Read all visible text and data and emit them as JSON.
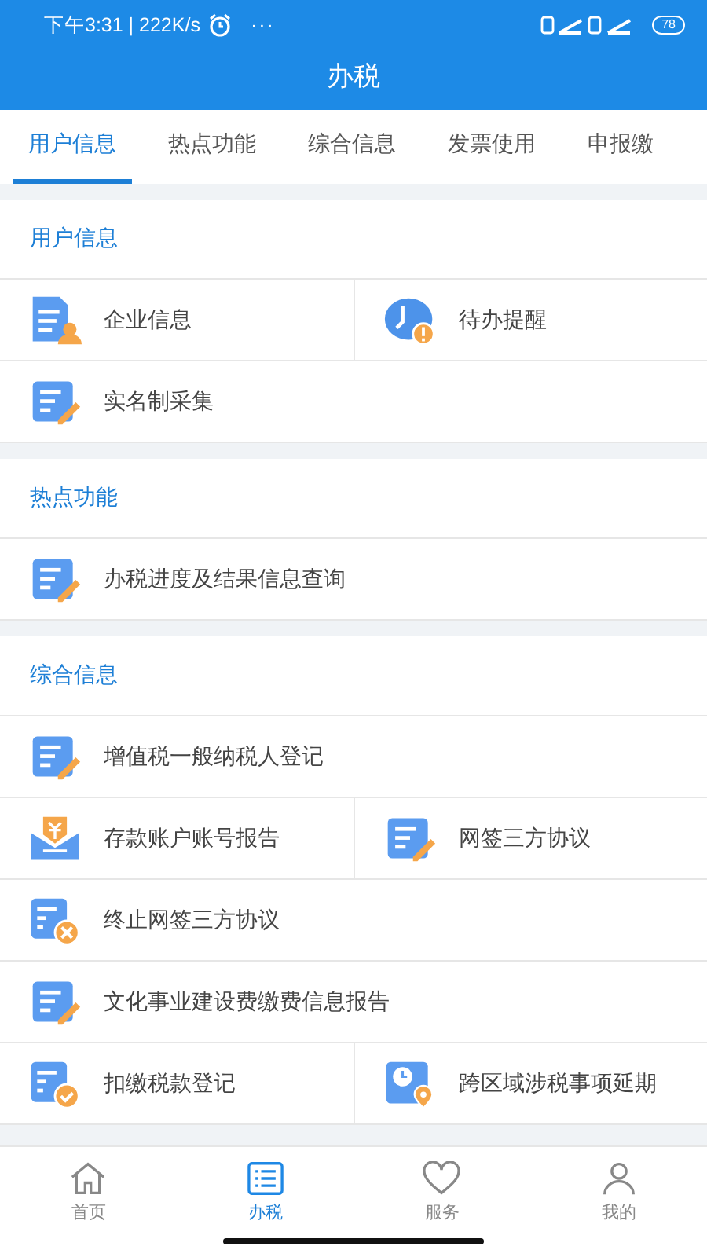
{
  "status_bar": {
    "time": "下午3:31 | 222K/s",
    "more": "···",
    "battery": "78"
  },
  "header": {
    "title": "办税"
  },
  "tabs": [
    {
      "label": "用户信息",
      "selected": true
    },
    {
      "label": "热点功能",
      "selected": false
    },
    {
      "label": "综合信息",
      "selected": false
    },
    {
      "label": "发票使用",
      "selected": false
    },
    {
      "label": "申报缴",
      "selected": false
    }
  ],
  "sections": [
    {
      "title": "用户信息",
      "rows": [
        [
          {
            "kind": "docperson",
            "label": "企业信息"
          },
          {
            "kind": "clockalert",
            "label": "待办提醒"
          }
        ],
        [
          {
            "kind": "docpen",
            "label": "实名制采集"
          }
        ]
      ]
    },
    {
      "title": "热点功能",
      "rows": [
        [
          {
            "kind": "docpen",
            "label": "办税进度及结果信息查询"
          }
        ]
      ]
    },
    {
      "title": "综合信息",
      "rows": [
        [
          {
            "kind": "docpen",
            "label": "增值税一般纳税人登记"
          }
        ],
        [
          {
            "kind": "envelope",
            "label": "存款账户账号报告"
          },
          {
            "kind": "docpen",
            "label": "网签三方协议"
          }
        ],
        [
          {
            "kind": "doccross",
            "label": "终止网签三方协议"
          }
        ],
        [
          {
            "kind": "docpen",
            "label": "文化事业建设费缴费信息报告"
          }
        ],
        [
          {
            "kind": "doccheck",
            "label": "扣缴税款登记"
          },
          {
            "kind": "clockpin",
            "label": "跨区域涉税事项延期"
          }
        ]
      ]
    }
  ],
  "bottom_nav": [
    {
      "label": "首页",
      "kind": "home",
      "selected": false
    },
    {
      "label": "办税",
      "kind": "list",
      "selected": true
    },
    {
      "label": "服务",
      "kind": "heart",
      "selected": false
    },
    {
      "label": "我的",
      "kind": "person",
      "selected": false
    }
  ]
}
